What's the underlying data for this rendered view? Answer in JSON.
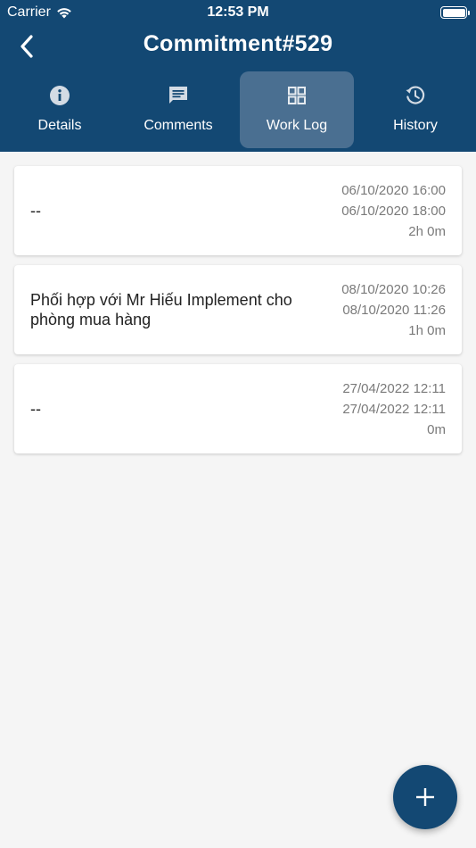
{
  "status_bar": {
    "carrier": "Carrier",
    "time": "12:53 PM"
  },
  "header": {
    "title": "Commitment#529"
  },
  "tabs": [
    {
      "label": "Details",
      "icon": "info-icon"
    },
    {
      "label": "Comments",
      "icon": "comment-icon"
    },
    {
      "label": "Work Log",
      "icon": "grid-icon",
      "active": true
    },
    {
      "label": "History",
      "icon": "history-icon"
    }
  ],
  "work_logs": [
    {
      "description": "--",
      "start": "06/10/2020 16:00",
      "end": "06/10/2020 18:00",
      "duration": "2h 0m"
    },
    {
      "description": "Phối hợp với Mr Hiếu Implement cho phòng mua hàng",
      "start": "08/10/2020 10:26",
      "end": "08/10/2020 11:26",
      "duration": "1h 0m"
    },
    {
      "description": "--",
      "start": "27/04/2022 12:11",
      "end": "27/04/2022 12:11",
      "duration": "0m"
    }
  ],
  "colors": {
    "primary": "#134873",
    "active_tab": "#4a6f91",
    "background": "#f5f5f5"
  }
}
